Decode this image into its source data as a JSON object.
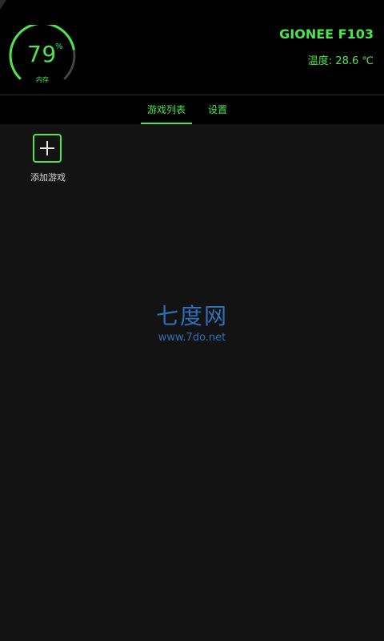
{
  "header": {
    "memory": {
      "value": "79",
      "unit": "%",
      "label": "内存",
      "percent": 79
    },
    "device_name": "GIONEE F103",
    "temperature": "温度: 28.6 ℃"
  },
  "tabs": [
    {
      "label": "游戏列表",
      "active": true
    },
    {
      "label": "设置",
      "active": false
    }
  ],
  "content": {
    "add_game_label": "添加游戏"
  },
  "watermark": {
    "title": "七度网",
    "url": "www.7do.net"
  },
  "colors": {
    "accent": "#4ee44e",
    "background": "#131313",
    "header_background": "#000000",
    "watermark": "#2f6fb7"
  },
  "icons": {
    "add": "plus-square-icon"
  }
}
